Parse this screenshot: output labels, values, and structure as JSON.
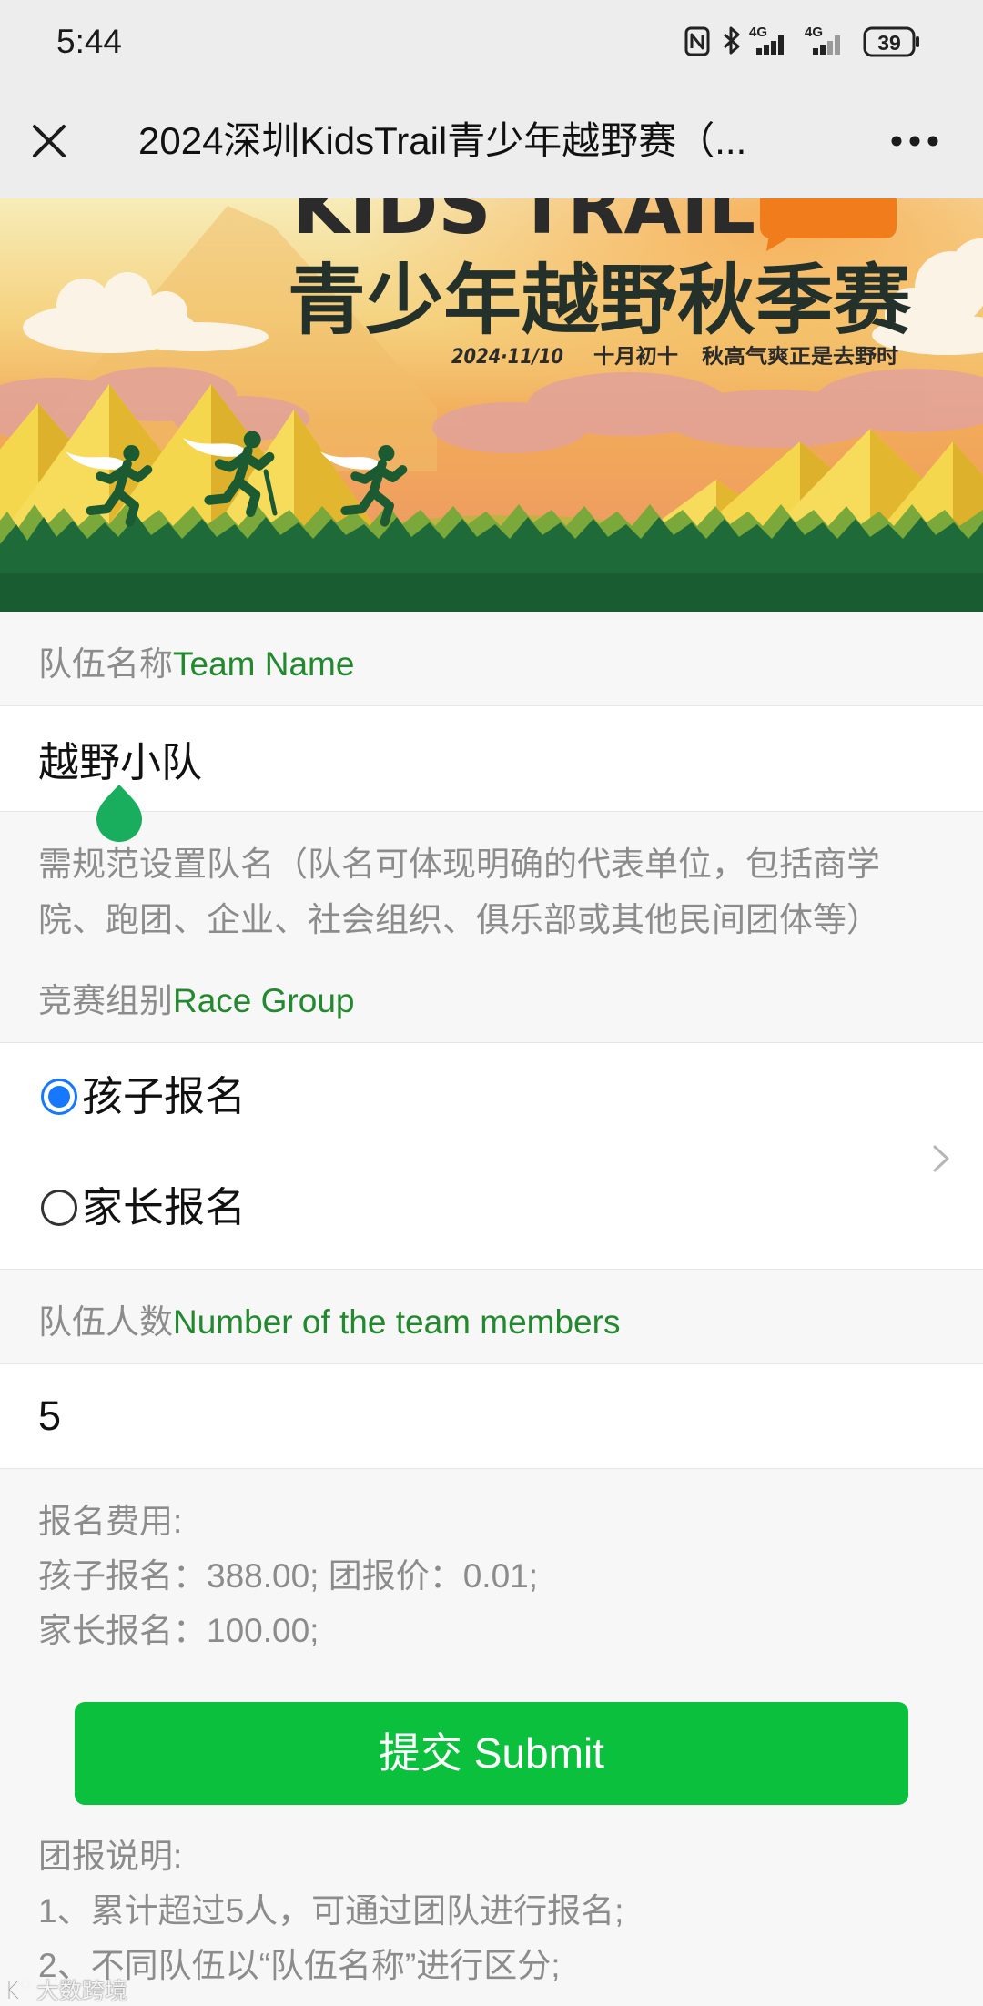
{
  "status_bar": {
    "time": "5:44",
    "icons": [
      "nfc-icon",
      "bluetooth-icon",
      "signal-icon",
      "signal-icon",
      "battery-icon"
    ],
    "network_labels": [
      "4G",
      "4G"
    ],
    "battery_level": "39"
  },
  "title_bar": {
    "close_icon": "close-icon",
    "title": "2024深圳KidsTrail青少年越野赛（...",
    "more_icon": "more-icon"
  },
  "banner": {
    "headline_en": "KIDS TRAIL",
    "headline_cn": "青少年越野秋季赛",
    "date": "2024·11/10",
    "lunar_date": "十月初十",
    "slogan": "秋高气爽正是去野时"
  },
  "form": {
    "team_name": {
      "label_cn": "队伍名称",
      "label_en": "Team Name",
      "value": "越野小队",
      "hint_lines": [
        "需规范设置队名（队名可体现明确的代表单位，包括商学",
        "院、跑团、企业、社会组织、俱乐部或其他民间团体等）"
      ]
    },
    "race_group": {
      "label_cn": "竞赛组别",
      "label_en": "Race Group",
      "options": [
        {
          "label": "孩子报名",
          "selected": true
        },
        {
          "label": "家长报名",
          "selected": false
        }
      ],
      "chevron_icon": "chevron-right-icon"
    },
    "team_members": {
      "label_cn": "队伍人数",
      "label_en": "Number of the team members",
      "value": "5"
    },
    "fees": {
      "heading": "报名费用:",
      "lines": [
        "孩子报名：388.00; 团报价：0.01;",
        "家长报名：100.00;"
      ]
    },
    "submit_label": "提交 Submit",
    "notes": {
      "heading": "团报说明:",
      "lines": [
        "1、累计超过5人，可通过团队进行报名;",
        "2、不同队伍以“队伍名称”进行区分;"
      ]
    }
  },
  "colors": {
    "submit_green": "#0ac03c",
    "label_green": "#23892e",
    "radio_blue": "#1677ff",
    "cursor_handle_green": "#18ae5d"
  },
  "watermark": "大数跨境"
}
